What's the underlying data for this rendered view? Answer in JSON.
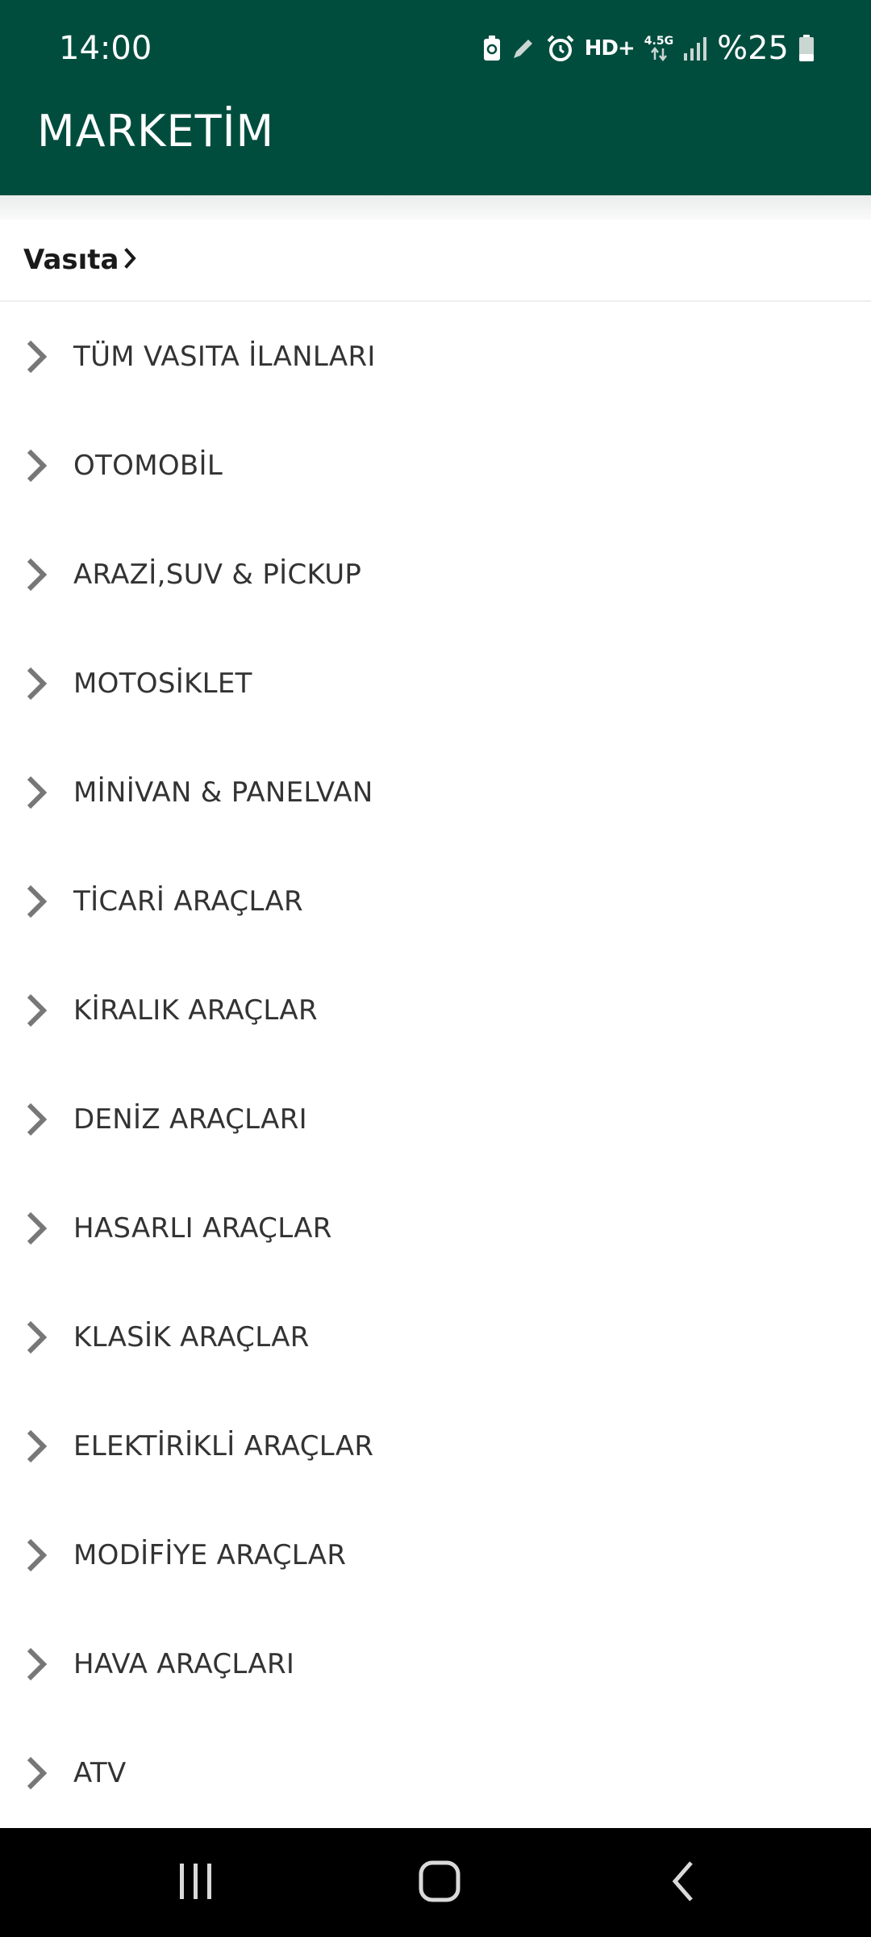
{
  "status_bar": {
    "time": "14:00",
    "network": "HD+",
    "network_gen": "4.5G",
    "battery": "%25",
    "icons": [
      "battery-saver-icon",
      "pencil-icon",
      "alarm-icon",
      "signal-icon",
      "battery-icon"
    ]
  },
  "app": {
    "title": "MARKETİM"
  },
  "breadcrumb": {
    "label": "Vasıta",
    "icon": "chevron-right-icon"
  },
  "categories": [
    {
      "label": "TÜM VASITA İLANLARI"
    },
    {
      "label": "OTOMOBİL"
    },
    {
      "label": "ARAZİ,SUV & PİCKUP"
    },
    {
      "label": "MOTOSİKLET"
    },
    {
      "label": "MİNİVAN & PANELVAN"
    },
    {
      "label": "TİCARİ ARAÇLAR"
    },
    {
      "label": "KİRALIK ARAÇLAR"
    },
    {
      "label": "DENİZ ARAÇLARI"
    },
    {
      "label": "HASARLI ARAÇLAR"
    },
    {
      "label": "KLASİK ARAÇLAR"
    },
    {
      "label": "ELEKTİRİKLİ ARAÇLAR"
    },
    {
      "label": "MODİFİYE ARAÇLAR"
    },
    {
      "label": "HAVA ARAÇLARI"
    },
    {
      "label": "ATV"
    }
  ],
  "nav_bar": {
    "buttons": [
      "recent-apps-icon",
      "home-icon",
      "back-icon"
    ]
  },
  "colors": {
    "header": "#004d3e",
    "chevron": "#777777",
    "text": "#333333"
  }
}
